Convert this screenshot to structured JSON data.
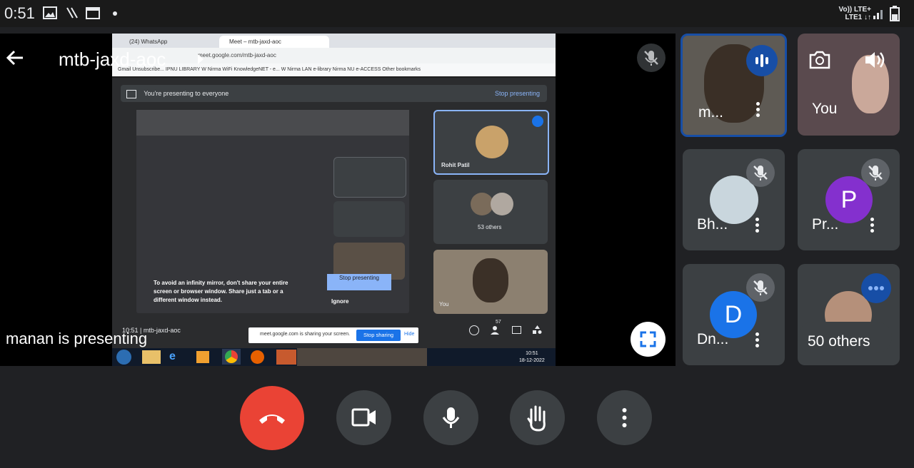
{
  "status_bar": {
    "time": "0:51",
    "network_line1": "Vo)) LTE+",
    "network_line2": "LTE1 ↓↑"
  },
  "meeting": {
    "code": "mtb-jaxd-aoc",
    "presenter_text": "manan is presenting"
  },
  "shared_screen": {
    "tabs": [
      "(24) WhatsApp",
      "Meet – mtb-jaxd-aoc"
    ],
    "address": "meet.google.com/mtb-jaxd-aoc",
    "bookmarks": "Gmail Unsubscribe...   IPNU LIBRARY   W Nirma WiFi   KnowledgeNET - e...   W Nirma LAN   e-library Nirma   NU e-ACCESS   Other bookmarks",
    "presenting_text": "You're presenting to everyone",
    "stop_presenting_link": "Stop presenting",
    "tile_rohit": "Rohit Patil",
    "tile_others": "53 others",
    "tile_you": "You",
    "mirror_warning": "To avoid an infinity mirror, don't share your entire screen or browser window. Share just a tab or a different window instead.",
    "stop_presenting_btn": "Stop presenting",
    "ignore_btn": "Ignore",
    "bottom_time": "10:51  |  mtb-jaxd-aoc",
    "participants_count": "57",
    "sharing_notice": "meet.google.com is sharing your screen.",
    "stop_sharing_btn": "Stop sharing",
    "hide_btn": "Hide",
    "taskbar_time": "10:51",
    "taskbar_date": "18-12-2022"
  },
  "participants": [
    {
      "name": "m...",
      "initial": "",
      "color": "#5f6368"
    },
    {
      "name": "You",
      "initial": "",
      "color": "#5f6368"
    },
    {
      "name": "Bh...",
      "initial": "",
      "color": "#5f6368"
    },
    {
      "name": "Pr...",
      "initial": "P",
      "color": "#8430ce"
    },
    {
      "name": "Dn...",
      "initial": "D",
      "color": "#1a73e8"
    },
    {
      "name": "50 others",
      "initial": "",
      "color": "#5f6368"
    }
  ],
  "colors": {
    "end_call": "#ea4335",
    "accent": "#1a73e8",
    "speaking": "#174ea6"
  }
}
